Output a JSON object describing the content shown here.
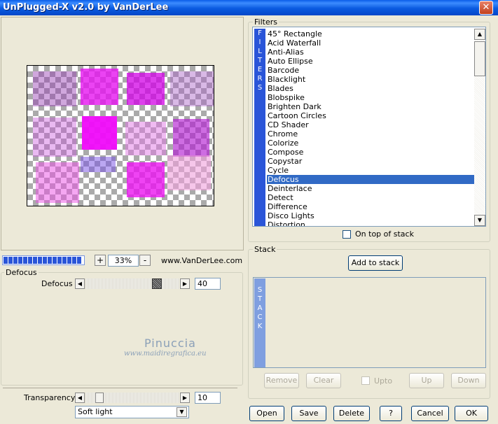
{
  "window": {
    "title": "UnPlugged-X v2.0 by VanDerLee",
    "close_glyph": "✕"
  },
  "zoom": {
    "minus": "-",
    "plus": "+",
    "value": "33%",
    "website": "www.VanDerLee.com"
  },
  "defocus_group": {
    "title": "Defocus",
    "slider_label": "Defocus",
    "value": "40"
  },
  "transparency": {
    "label": "Transparency",
    "value": "10",
    "blend_mode": "Soft light"
  },
  "watermark": {
    "name": "Pinuccia",
    "url": "www.maidiregrafica.eu"
  },
  "filters": {
    "group_title": "Filters",
    "strip_letters": [
      "F",
      "I",
      "L",
      "T",
      "E",
      "R",
      "S"
    ],
    "items": [
      "45° Rectangle",
      "Acid Waterfall",
      "Anti-Alias",
      "Auto Ellipse",
      "Barcode",
      "Blacklight",
      "Blades",
      "Blobspike",
      "Brighten Dark",
      "Cartoon Circles",
      "CD Shader",
      "Chrome",
      "Colorize",
      "Compose",
      "Copystar",
      "Cycle",
      "Defocus",
      "Deinterlace",
      "Detect",
      "Difference",
      "Disco Lights",
      "Distortion"
    ],
    "selected": "Defocus",
    "on_top_label": "On top of stack"
  },
  "stack": {
    "group_title": "Stack",
    "add_button": "Add to stack",
    "strip_letters": [
      "S",
      "T",
      "A",
      "C",
      "K"
    ],
    "remove": "Remove",
    "clear": "Clear",
    "upto": "Upto",
    "up": "Up",
    "down": "Down"
  },
  "buttons": {
    "open": "Open",
    "save": "Save",
    "delete": "Delete",
    "help": "?",
    "cancel": "Cancel",
    "ok": "OK"
  },
  "colors": {
    "accent": "#316ac5",
    "magenta": "#e010f0"
  }
}
